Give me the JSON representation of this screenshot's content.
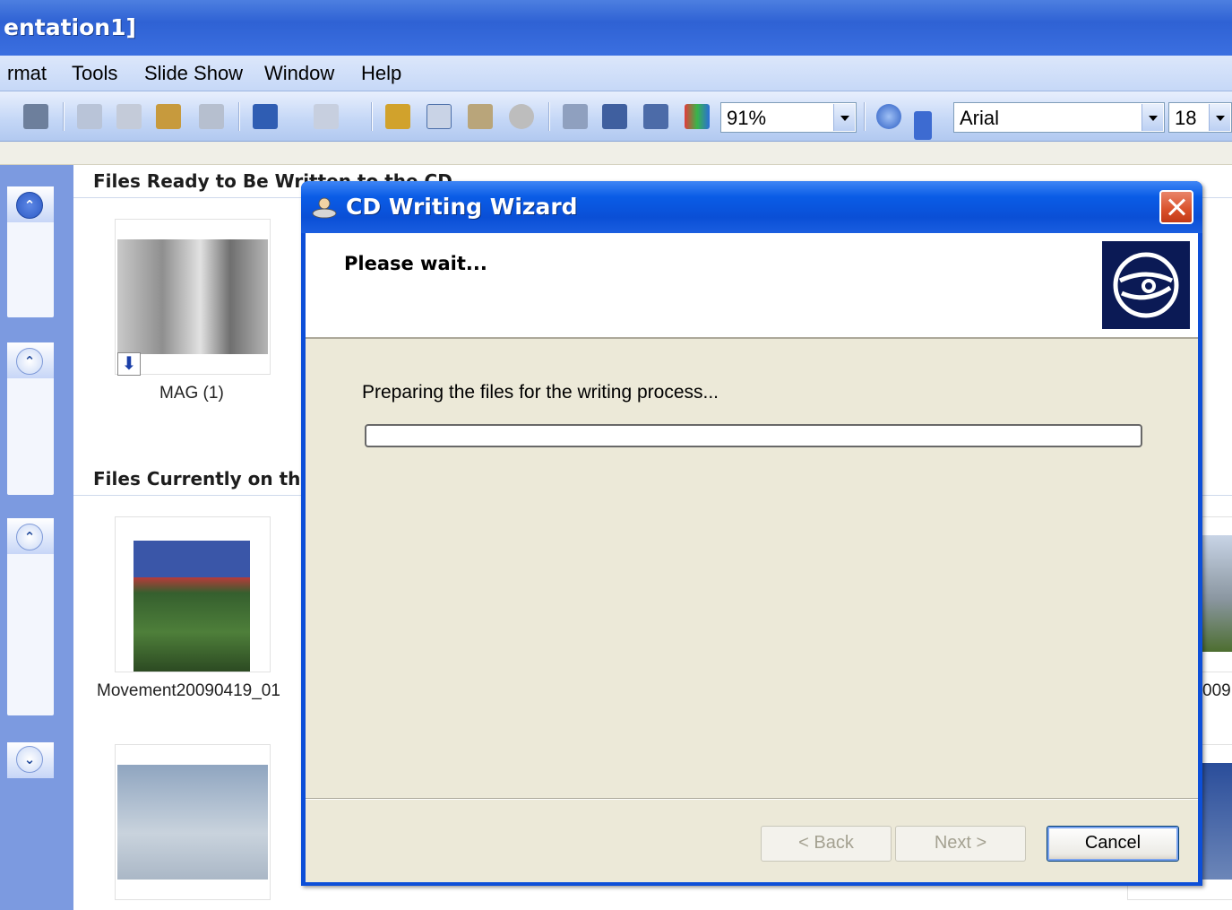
{
  "window": {
    "title": "entation1]"
  },
  "menubar": {
    "items": [
      "rmat",
      "Tools",
      "Slide Show",
      "Window",
      "Help"
    ]
  },
  "toolbar": {
    "zoom": "91%",
    "font": "Arial",
    "font_size": "18"
  },
  "content": {
    "ready_title": "Files Ready to Be Written to the CD",
    "current_title": "Files Currently on the CD",
    "ready_files": [
      "MAG (1)"
    ],
    "current_files": [
      "Movement20090419_01",
      "009"
    ]
  },
  "dialog": {
    "title": "CD Writing Wizard",
    "heading": "Please wait...",
    "status": "Preparing the files for the writing process...",
    "progress": 0,
    "buttons": {
      "back": "< Back",
      "next": "Next >",
      "cancel": "Cancel"
    }
  },
  "colors": {
    "xp_title": "#0a4fd6",
    "dialog_face": "#ece9d8",
    "task_pane": "#7c9ae0"
  }
}
